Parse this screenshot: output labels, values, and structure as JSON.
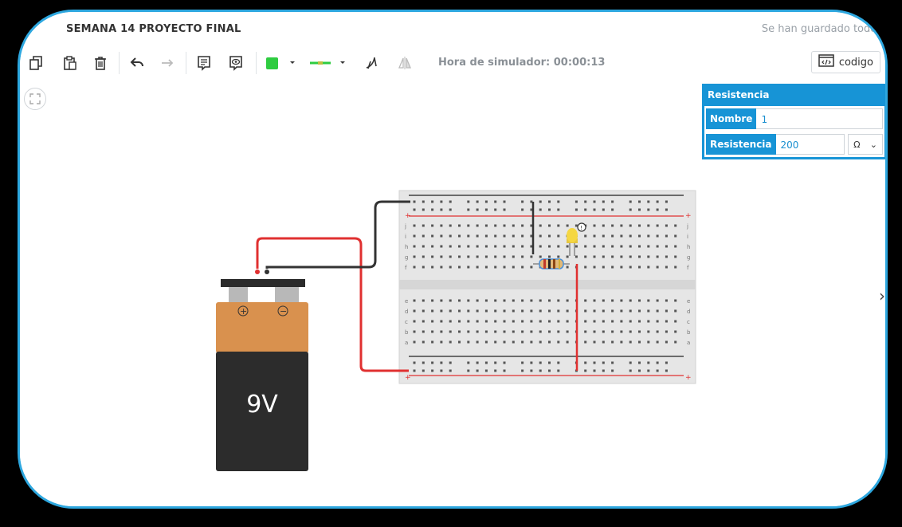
{
  "app": {
    "title": "SEMANA 14 PROYECTO FINAL",
    "save_status": "Se han guardado todos"
  },
  "toolbar": {
    "sim_time_label": "Hora de simulador: 00:00:13",
    "code_label": "codigo",
    "fill_color": "#2ecc40",
    "wire_color": "#2ecc40",
    "icons": [
      "copy-icon",
      "paste-icon",
      "delete-icon",
      "undo-icon",
      "redo-icon",
      "notes-icon",
      "show-notes-icon",
      "color-picker-icon",
      "wire-type-icon",
      "rotate-icon",
      "mirror-icon"
    ]
  },
  "inspector": {
    "title": "Resistencia",
    "name_label": "Nombre",
    "name_value": "1",
    "resistance_label": "Resistencia",
    "resistance_value": "200",
    "unit": "Ω"
  },
  "circuit": {
    "battery_label": "9V",
    "battery_plus": "+",
    "battery_minus": "−",
    "rail_plus": "+",
    "rail_minus": "−",
    "row_letters_top": [
      "j",
      "i",
      "h",
      "g",
      "f"
    ],
    "row_letters_bottom": [
      "e",
      "d",
      "c",
      "b",
      "a"
    ],
    "colors": {
      "battery_top": "#d9914e",
      "battery_body": "#2c2c2c",
      "wire_red": "#e03030",
      "wire_black": "#333333",
      "breadboard": "#e6e6e6",
      "led": "#f5d742"
    }
  }
}
